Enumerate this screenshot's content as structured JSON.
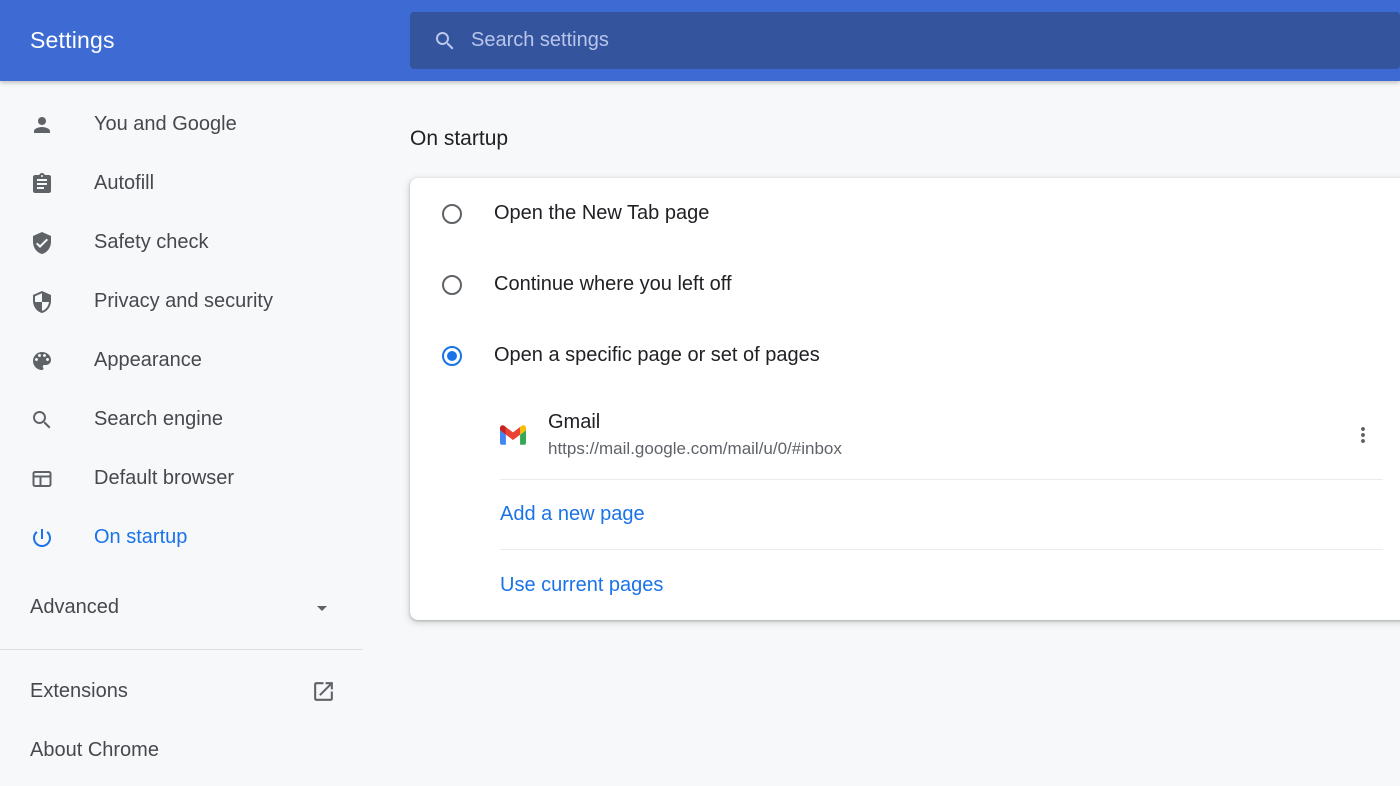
{
  "header": {
    "title": "Settings",
    "search_placeholder": "Search settings",
    "search_icon": "magnifier-icon"
  },
  "sidebar": {
    "items": [
      {
        "label": "You and Google",
        "icon": "person-icon",
        "selected": false
      },
      {
        "label": "Autofill",
        "icon": "clipboard-icon",
        "selected": false
      },
      {
        "label": "Safety check",
        "icon": "shield-check-icon",
        "selected": false
      },
      {
        "label": "Privacy and security",
        "icon": "shield-half-icon",
        "selected": false
      },
      {
        "label": "Appearance",
        "icon": "palette-icon",
        "selected": false
      },
      {
        "label": "Search engine",
        "icon": "search-icon",
        "selected": false
      },
      {
        "label": "Default browser",
        "icon": "browser-window-icon",
        "selected": false
      },
      {
        "label": "On startup",
        "icon": "power-icon",
        "selected": true
      }
    ],
    "advanced_label": "Advanced",
    "advanced_icon": "chevron-down-icon",
    "extensions_label": "Extensions",
    "extensions_icon": "open-in-new-icon",
    "about_label": "About Chrome"
  },
  "main": {
    "heading": "On startup",
    "options": [
      {
        "label": "Open the New Tab page",
        "selected": false
      },
      {
        "label": "Continue where you left off",
        "selected": false
      },
      {
        "label": "Open a specific page or set of pages",
        "selected": true
      }
    ],
    "site": {
      "name": "Gmail",
      "url": "https://mail.google.com/mail/u/0/#inbox",
      "favicon": "gmail-icon",
      "menu_icon": "more-vert-icon"
    },
    "links": {
      "add_page": "Add a new page",
      "use_current": "Use current pages"
    }
  },
  "colors": {
    "header-bg": "#3e6bd3",
    "search-bg": "#34559e",
    "accent": "#1a73e8",
    "page-bg": "#f7f8f9",
    "card-bg": "#ffffff",
    "text-primary": "#202124",
    "text-secondary": "#5f6368",
    "nav-text": "#45494e",
    "placeholder": "#b9c5ea"
  }
}
